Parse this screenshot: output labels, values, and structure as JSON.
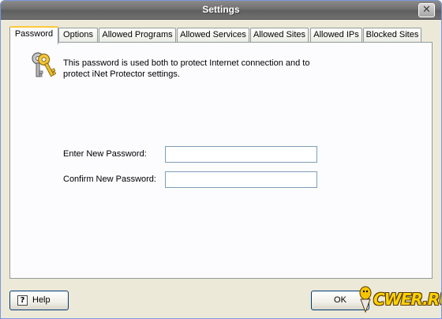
{
  "window": {
    "title": "Settings",
    "close_glyph": "✕"
  },
  "tabs": [
    {
      "label": "Password",
      "active": true
    },
    {
      "label": "Options"
    },
    {
      "label": "Allowed Programs"
    },
    {
      "label": "Allowed Services"
    },
    {
      "label": "Allowed Sites"
    },
    {
      "label": "Allowed IPs"
    },
    {
      "label": "Blocked Sites"
    }
  ],
  "password_panel": {
    "icon": "keys-icon",
    "info_text": "This password is used both to protect Internet connection and to protect iNet Protector settings.",
    "new_password_label": "Enter New Password:",
    "new_password_value": "",
    "confirm_password_label": "Confirm New Password:",
    "confirm_password_value": ""
  },
  "buttons": {
    "help_label": "Help",
    "help_icon_glyph": "?",
    "ok_label": "OK"
  },
  "watermark": {
    "text": "CWER.RU"
  },
  "colors": {
    "title_bar": "#6f6f6f",
    "dialog_bg": "#ece9d8",
    "active_tab_accent": "#ffc83c"
  }
}
